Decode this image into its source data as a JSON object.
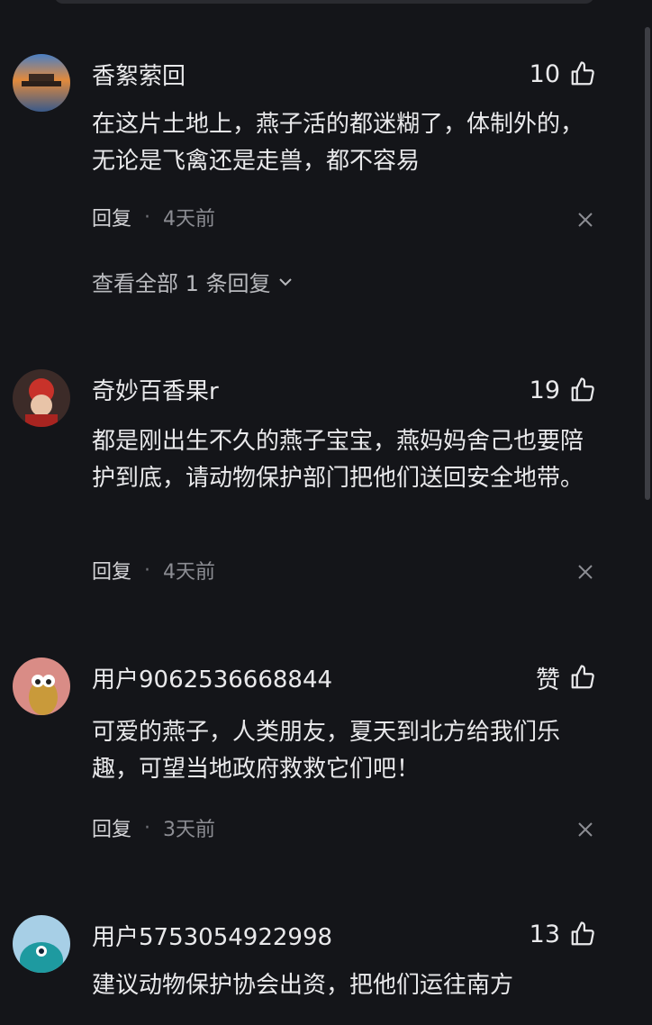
{
  "comments": [
    {
      "username": "香絮萦回",
      "likes": "10",
      "text": "在这片土地上，燕子活的都迷糊了，体制外的，无论是飞禽还是走兽，都不容易",
      "reply_label": "回复",
      "time": "4天前",
      "view_replies": "查看全部 1 条回复"
    },
    {
      "username": "奇妙百香果r",
      "likes": "19",
      "text": "都是刚出生不久的燕子宝宝，燕妈妈舍己也要陪护到底，请动物保护部门把他们送回安全地带。",
      "reply_label": "回复",
      "time": "4天前"
    },
    {
      "username": "用户9062536668844",
      "likes": "赞",
      "text": "可爱的燕子，人类朋友，夏天到北方给我们乐趣，可望当地政府救救它们吧！",
      "reply_label": "回复",
      "time": "3天前"
    },
    {
      "username": "用户5753054922998",
      "likes": "13",
      "text": "建议动物保护协会出资，把他们运往南方"
    }
  ],
  "separator": "·",
  "colors": {
    "background": "#141519",
    "text": "#e9e9eb",
    "muted": "#8c8d93"
  }
}
